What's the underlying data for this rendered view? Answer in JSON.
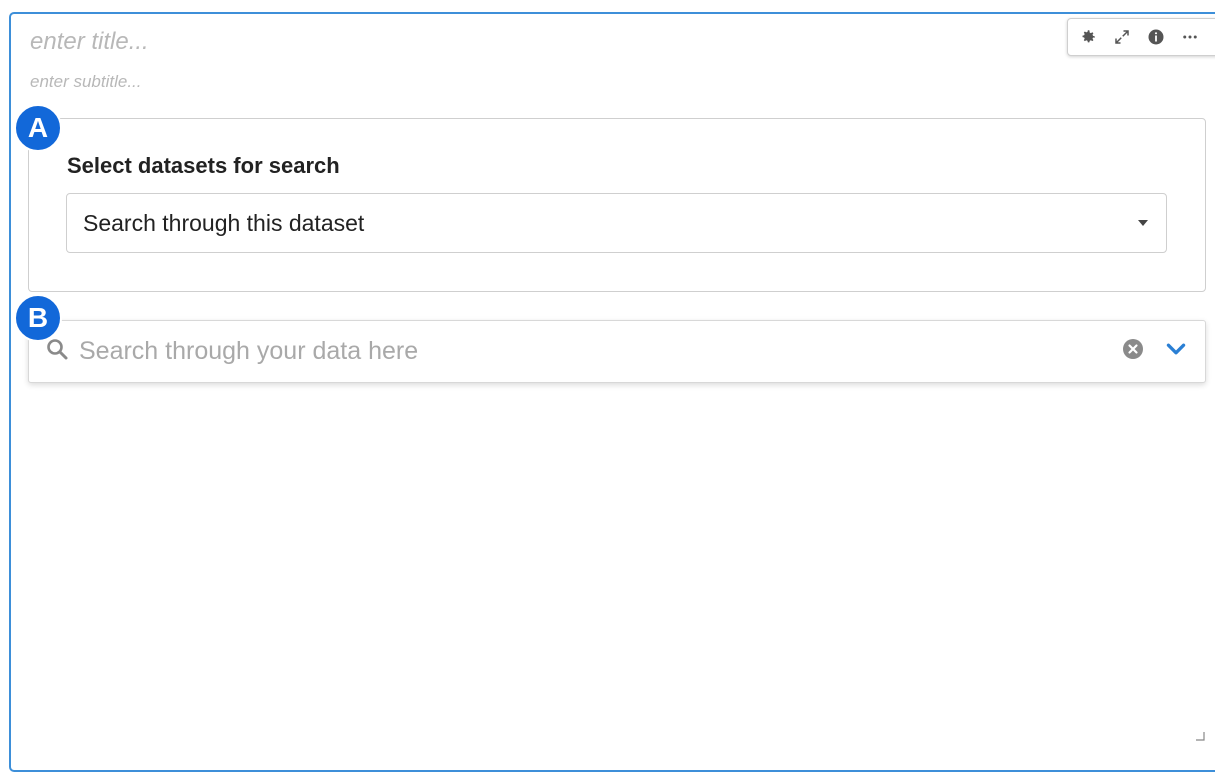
{
  "widget": {
    "title_placeholder": "enter title...",
    "subtitle_placeholder": "enter subtitle..."
  },
  "toolbar": {
    "icons": [
      "gear-icon",
      "expand-icon",
      "info-icon",
      "more-icon"
    ]
  },
  "section_a": {
    "badge": "A",
    "label": "Select datasets for search",
    "selected_value": "Search through this dataset"
  },
  "section_b": {
    "badge": "B",
    "search_placeholder": "Search through your data here",
    "search_value": ""
  },
  "colors": {
    "accent_border": "#3d8fd9",
    "badge": "#1268d9",
    "chevron": "#2a7fd4"
  }
}
